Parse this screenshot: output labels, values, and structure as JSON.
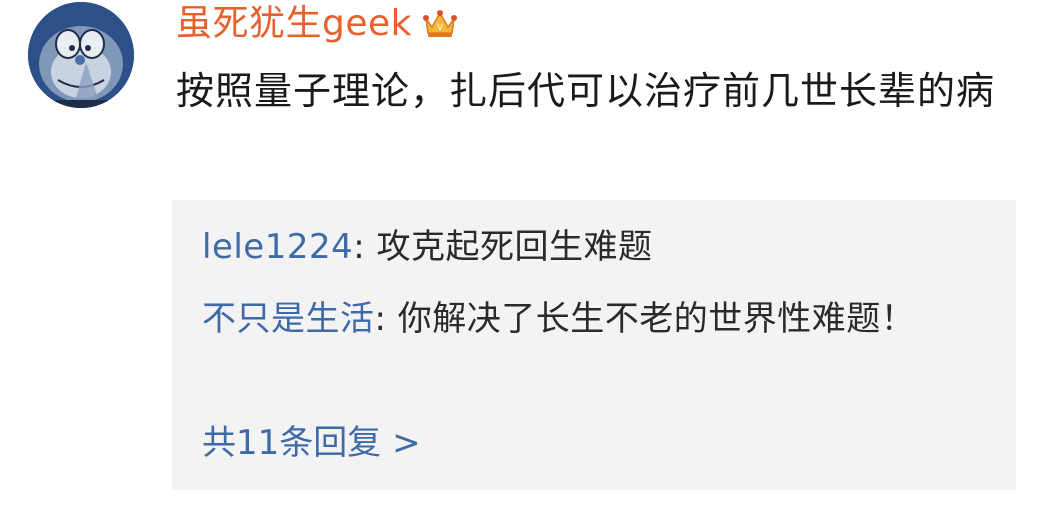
{
  "comment": {
    "username": "虽死犹生geek",
    "content": "按照量子理论，扎后代可以治疗前几世长辈的病",
    "avatar_icon": "doraemon-avatar-icon",
    "badge_icon": "vip-crown-icon"
  },
  "replies": [
    {
      "author": "lele1224",
      "separator": ": ",
      "text": "攻克起死回生难题"
    },
    {
      "author": "不只是生活",
      "separator": ": ",
      "text": "你解决了长生不老的世界性难题！"
    }
  ],
  "more_replies": "共11条回复 >",
  "colors": {
    "username": "#e8612c",
    "link": "#3f6aa8",
    "reply_bg": "#f3f3f3",
    "text": "#1a1a1a"
  }
}
